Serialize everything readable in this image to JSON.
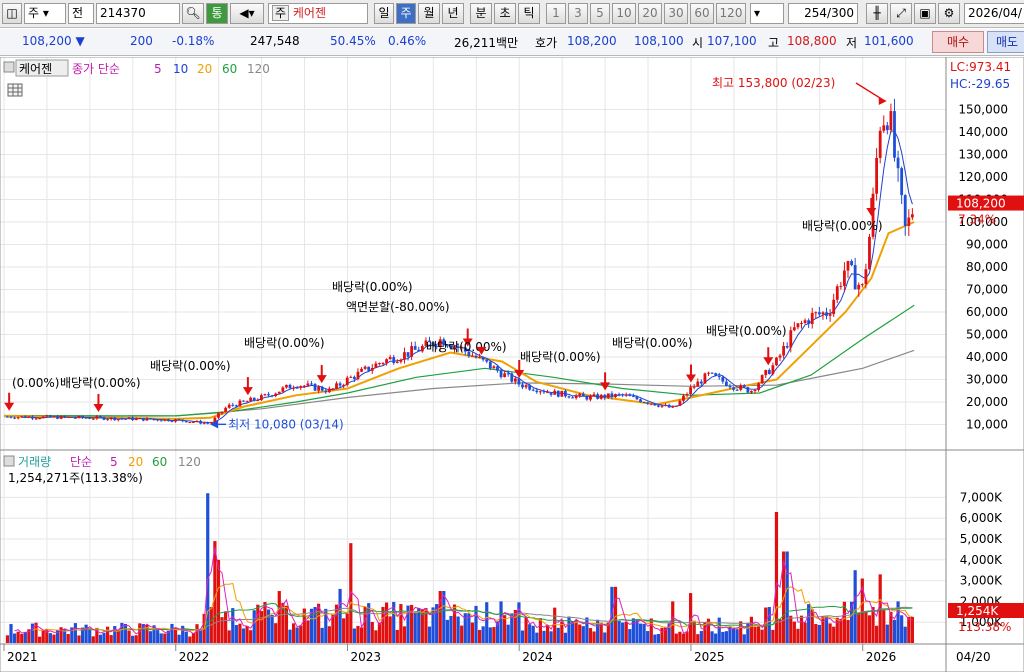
{
  "toolbar": {
    "market": "주",
    "market2": "전",
    "code": "214370",
    "connect_label": "통",
    "market_tag": "주",
    "stock_name": "케어젠",
    "periods": [
      "일",
      "주",
      "월",
      "년",
      "분",
      "초",
      "틱"
    ],
    "active_period": "주",
    "intervals": [
      "1",
      "3",
      "5",
      "10",
      "20",
      "30",
      "60",
      "120"
    ],
    "count": "254",
    "count_total": "/300",
    "date": "2026/04/"
  },
  "quote": {
    "price": "108,200",
    "direction": "▼",
    "change": "200",
    "change_pct": "-0.18%",
    "volume": "247,548",
    "vol_ratio": "50.45%",
    "turnover": "0.46%",
    "amount": "26,211백만",
    "bid_label": "호가",
    "bid1": "108,200",
    "bid2": "108,100",
    "open_label": "시",
    "open": "107,100",
    "high_label": "고",
    "high": "108,800",
    "low_label": "저",
    "low": "101,600",
    "buy_label": "매수",
    "sell_label": "매도"
  },
  "colors": {
    "up": "#e01010",
    "down": "#1f4fd8",
    "ma5": "#2040d0",
    "ma10": "#2040d0",
    "ma20": "#f0a000",
    "ma60": "#20a040",
    "ma120": "#888888",
    "vol_ma5": "#e020c0",
    "grid": "#e6e6e6"
  },
  "chart_data": [
    {
      "type": "candlestick",
      "title": "케어젠",
      "legend": {
        "prefix": "종가 단순",
        "items": [
          "5",
          "10",
          "20",
          "60",
          "120"
        ]
      },
      "ylim": [
        0,
        160000
      ],
      "yticks": [
        10000,
        20000,
        30000,
        40000,
        50000,
        60000,
        70000,
        80000,
        90000,
        100000,
        110000,
        120000,
        130000,
        140000,
        150000
      ],
      "ytick_labels": [
        "10,000",
        "20,000",
        "30,000",
        "40,000",
        "50,000",
        "60,000",
        "70,000",
        "80,000",
        "90,000",
        "100,000",
        "110,000",
        "120,000",
        "130,000",
        "140,000",
        "150,000"
      ],
      "lc": "LC:973.41",
      "hc": "HC:-29.65",
      "last_price_label": "108,200",
      "last_price_pct": "7.34%",
      "last_price": 108200,
      "high_annotation": "최고 153,800 (02/23)",
      "high_value": 153800,
      "low_annotation": "최저 10,080 (03/14)",
      "low_value": 10080,
      "dividend_annotations": [
        "(0.00%)",
        "배당락(0.00%)",
        "배당락(0.00%)",
        "배당락(0.00%)",
        "배당락(0.00%)",
        "배당락(0.00%)",
        "배당락(0.00%)",
        "배당락(0.00%)",
        "배당락(0.00%)",
        "배당락(0.00%)"
      ],
      "split_annotation": "액면분할(-80.00%)",
      "price_path": [
        [
          2021.0,
          13500
        ],
        [
          2021.5,
          13000
        ],
        [
          2022.0,
          12000
        ],
        [
          2022.2,
          10500
        ],
        [
          2022.3,
          18000
        ],
        [
          2022.5,
          22000
        ],
        [
          2022.7,
          28000
        ],
        [
          2022.9,
          25000
        ],
        [
          2023.0,
          30000
        ],
        [
          2023.2,
          38000
        ],
        [
          2023.4,
          43000
        ],
        [
          2023.55,
          48000
        ],
        [
          2023.7,
          42000
        ],
        [
          2023.85,
          35000
        ],
        [
          2024.0,
          28000
        ],
        [
          2024.2,
          24000
        ],
        [
          2024.4,
          22000
        ],
        [
          2024.6,
          23000
        ],
        [
          2024.8,
          19000
        ],
        [
          2024.9,
          17000
        ],
        [
          2025.0,
          26000
        ],
        [
          2025.1,
          32000
        ],
        [
          2025.25,
          27000
        ],
        [
          2025.35,
          25000
        ],
        [
          2025.5,
          38000
        ],
        [
          2025.6,
          52000
        ],
        [
          2025.7,
          58000
        ],
        [
          2025.8,
          60000
        ],
        [
          2025.9,
          80000
        ],
        [
          2026.0,
          70000
        ],
        [
          2026.05,
          100000
        ],
        [
          2026.1,
          145000
        ],
        [
          2026.15,
          150000
        ],
        [
          2026.2,
          120000
        ],
        [
          2026.25,
          95000
        ],
        [
          2026.3,
          108200
        ]
      ],
      "ma20_path": [
        [
          2021.0,
          13800
        ],
        [
          2022.0,
          12500
        ],
        [
          2022.2,
          13000
        ],
        [
          2022.4,
          18000
        ],
        [
          2022.7,
          23000
        ],
        [
          2023.0,
          26000
        ],
        [
          2023.3,
          35000
        ],
        [
          2023.6,
          42000
        ],
        [
          2023.9,
          38000
        ],
        [
          2024.1,
          29000
        ],
        [
          2024.4,
          23000
        ],
        [
          2024.8,
          19000
        ],
        [
          2025.0,
          22000
        ],
        [
          2025.3,
          27000
        ],
        [
          2025.5,
          30000
        ],
        [
          2025.7,
          45000
        ],
        [
          2025.9,
          60000
        ],
        [
          2026.05,
          75000
        ],
        [
          2026.15,
          95000
        ],
        [
          2026.3,
          100000
        ]
      ],
      "ma60_path": [
        [
          2021.0,
          14000
        ],
        [
          2022.0,
          13800
        ],
        [
          2022.3,
          15500
        ],
        [
          2022.7,
          20000
        ],
        [
          2023.0,
          24000
        ],
        [
          2023.4,
          31000
        ],
        [
          2023.8,
          35000
        ],
        [
          2024.2,
          31000
        ],
        [
          2024.6,
          26000
        ],
        [
          2025.0,
          23000
        ],
        [
          2025.4,
          24000
        ],
        [
          2025.7,
          32000
        ],
        [
          2026.0,
          48000
        ],
        [
          2026.3,
          63000
        ]
      ],
      "ma120_path": [
        [
          2021.0,
          13500
        ],
        [
          2022.0,
          13800
        ],
        [
          2022.5,
          17000
        ],
        [
          2023.0,
          22000
        ],
        [
          2023.5,
          26000
        ],
        [
          2024.0,
          28500
        ],
        [
          2024.5,
          28000
        ],
        [
          2025.0,
          27000
        ],
        [
          2025.5,
          27500
        ],
        [
          2025.8,
          32000
        ],
        [
          2026.0,
          35000
        ],
        [
          2026.3,
          43000
        ]
      ]
    },
    {
      "type": "bar",
      "title": "거래량",
      "legend": {
        "prefix": "단순",
        "items": [
          "5",
          "20",
          "60",
          "120"
        ]
      },
      "info": "1,254,271주(113.38%)",
      "ylim": [
        0,
        7500
      ],
      "yticks": [
        1000,
        2000,
        3000,
        4000,
        5000,
        6000,
        7000
      ],
      "ytick_labels": [
        "1,000K",
        "2,000K",
        "3,000K",
        "4,000K",
        "5,000K",
        "6,000K",
        "7,000K"
      ],
      "last_volume_label": "1,254K",
      "last_volume_pct": "113.38%",
      "spikes": [
        [
          2022.18,
          7200
        ],
        [
          2022.22,
          4900
        ],
        [
          2022.25,
          4000
        ],
        [
          2022.6,
          2500
        ],
        [
          2022.95,
          2600
        ],
        [
          2023.02,
          4800
        ],
        [
          2023.35,
          1800
        ],
        [
          2023.55,
          2500
        ],
        [
          2023.9,
          2000
        ],
        [
          2024.2,
          1700
        ],
        [
          2024.55,
          2700
        ],
        [
          2024.9,
          2000
        ],
        [
          2025.0,
          2400
        ],
        [
          2025.5,
          6300
        ],
        [
          2025.55,
          4400
        ],
        [
          2025.95,
          3500
        ],
        [
          2026.0,
          3100
        ],
        [
          2026.1,
          3300
        ],
        [
          2026.2,
          2000
        ],
        [
          2026.28,
          1254
        ]
      ]
    }
  ],
  "x_axis": {
    "labels": [
      "2021",
      "2022",
      "2023",
      "2024",
      "2025",
      "2026"
    ],
    "values": [
      2021.0,
      2022.0,
      2023.0,
      2024.0,
      2025.0,
      2026.0
    ],
    "range": [
      2021.0,
      2026.45
    ],
    "end_label": "04/20"
  }
}
